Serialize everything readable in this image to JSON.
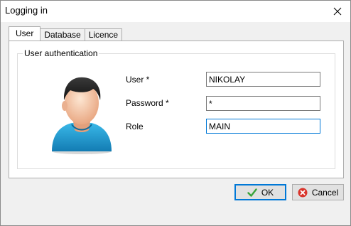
{
  "window": {
    "title": "Logging in"
  },
  "tabs": [
    {
      "label": "User",
      "active": true
    },
    {
      "label": "Database",
      "active": false
    },
    {
      "label": "Licence",
      "active": false
    }
  ],
  "group": {
    "label": "User authentication"
  },
  "fields": {
    "user": {
      "label": "User *",
      "value": "NIKOLAY"
    },
    "password": {
      "label": "Password *",
      "value": "*"
    },
    "role": {
      "label": "Role",
      "value": "MAIN"
    }
  },
  "buttons": {
    "ok": "OK",
    "cancel": "Cancel"
  },
  "icons": {
    "close": "close-icon",
    "avatar": "user-avatar-icon",
    "ok": "checkmark-icon",
    "cancel": "cancel-icon"
  },
  "colors": {
    "accent": "#0078d7",
    "ok_icon": "#3aa33a",
    "cancel_icon": "#d9342b",
    "shirt": "#1fa2d8"
  }
}
